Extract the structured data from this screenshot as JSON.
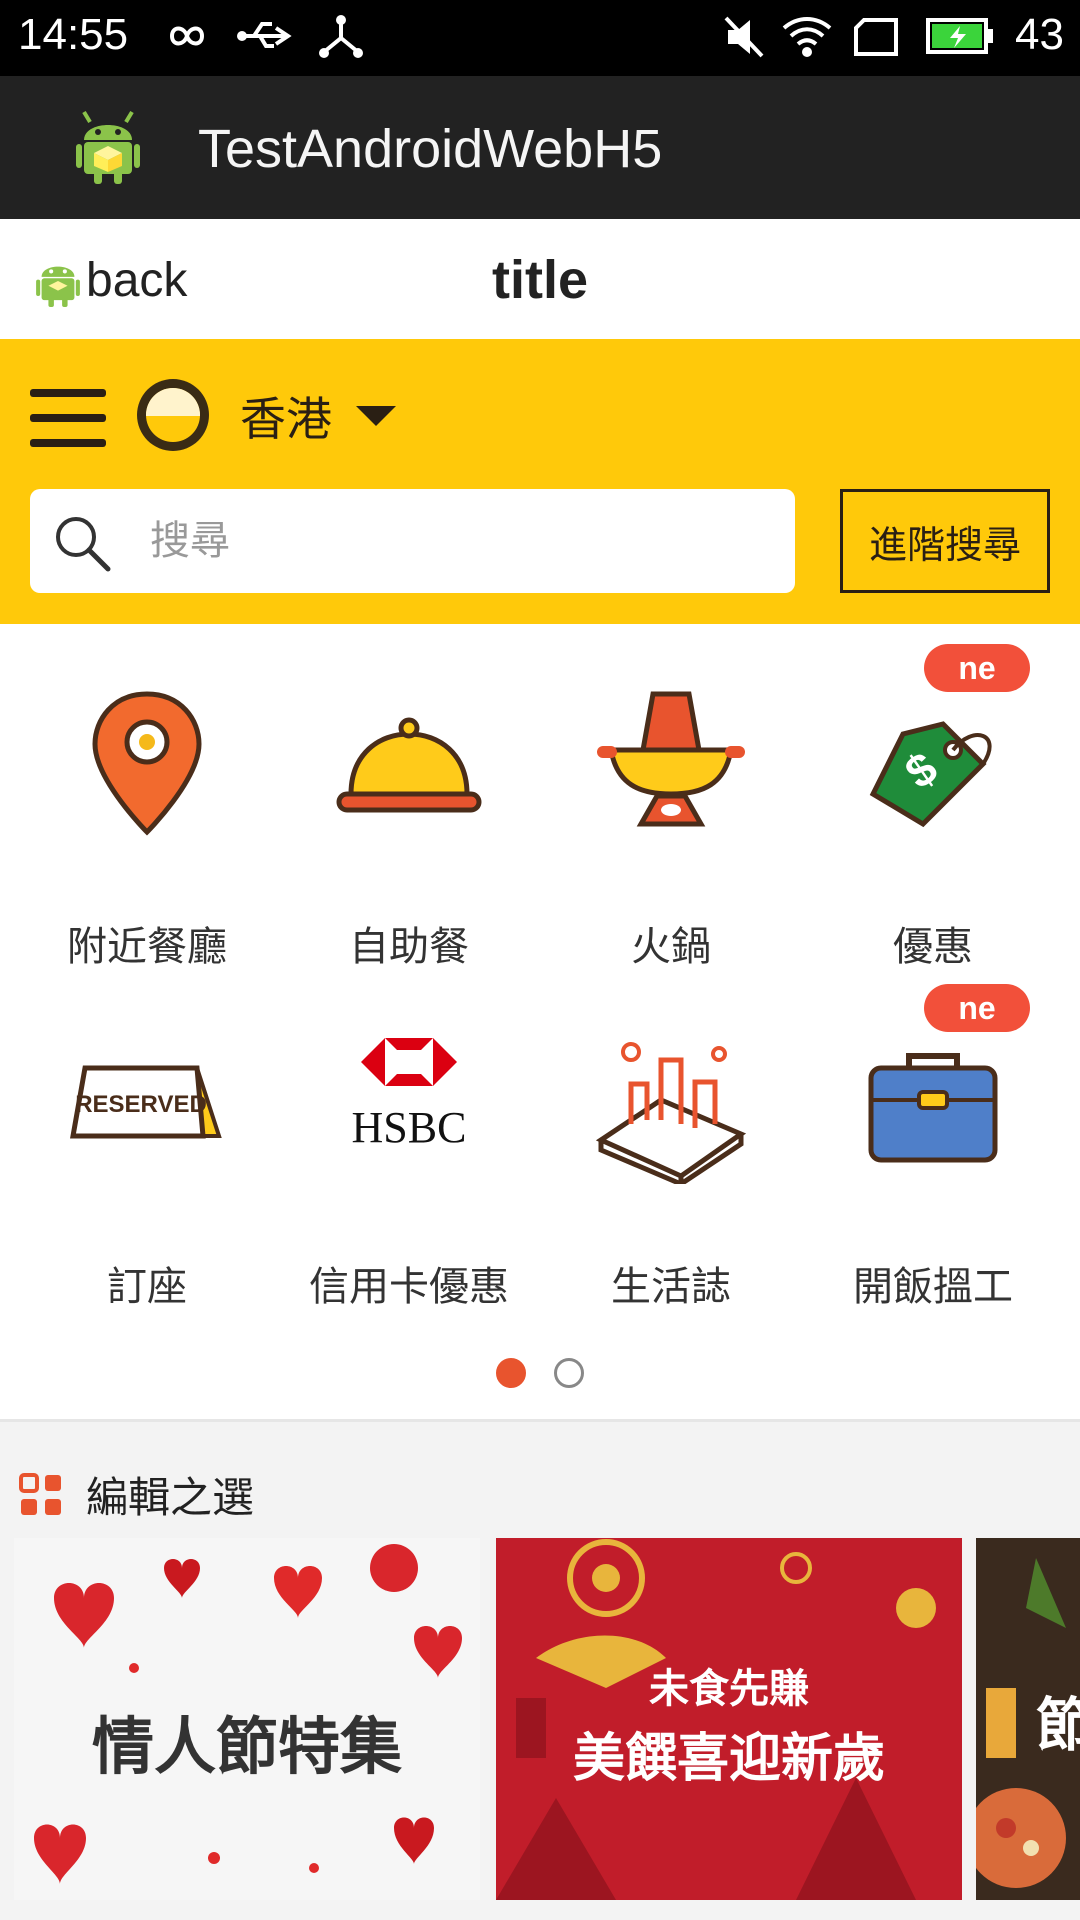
{
  "status_bar": {
    "time": "14:55",
    "battery": "43"
  },
  "action_bar": {
    "app_name": "TestAndroidWebH5"
  },
  "web_header": {
    "back_label": "back",
    "title": "title"
  },
  "top_bar": {
    "region": "香港",
    "search_placeholder": "搜尋",
    "advanced_search_label": "進階搜尋"
  },
  "categories": [
    {
      "label": "附近餐廳",
      "icon": "location-pin-icon"
    },
    {
      "label": "自助餐",
      "icon": "food-cloche-icon"
    },
    {
      "label": "火鍋",
      "icon": "hotpot-icon"
    },
    {
      "label": "優惠",
      "icon": "price-tag-icon",
      "badge": "ne"
    },
    {
      "label": "訂座",
      "icon": "reserved-sign-icon",
      "reserved_text": "RESERVED"
    },
    {
      "label": "信用卡優惠",
      "icon": "hsbc-logo-icon",
      "logo_text": "HSBC"
    },
    {
      "label": "生活誌",
      "icon": "city-magazine-icon"
    },
    {
      "label": "開飯搵工",
      "icon": "briefcase-icon",
      "badge": "ne"
    }
  ],
  "pager": {
    "pages": 2,
    "active": 0
  },
  "editor_picks": {
    "title": "編輯之選",
    "cards": [
      {
        "text": "情人節特集"
      },
      {
        "brand": "未食先賺",
        "text": "美饌喜迎新歲"
      },
      {
        "text": "節"
      }
    ]
  },
  "colors": {
    "accent_yellow": "#ffc90a",
    "accent_orange": "#e8542e",
    "badge_red": "#f2503a"
  }
}
